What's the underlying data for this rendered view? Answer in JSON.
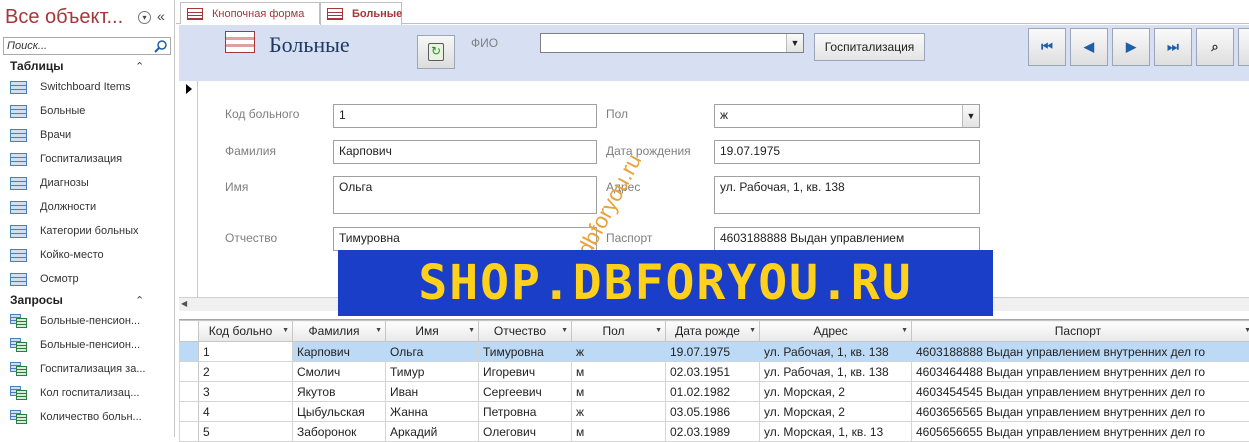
{
  "nav": {
    "title": "Все объект...",
    "search_placeholder": "Поиск...",
    "groups": [
      {
        "label": "Таблицы",
        "items": [
          "Switchboard Items",
          "Больные",
          "Врачи",
          "Госпитализация",
          "Диагнозы",
          "Должности",
          "Категории больных",
          "Койко-место",
          "Осмотр"
        ]
      },
      {
        "label": "Запросы",
        "items": [
          "Больные-пенсион...",
          "Больные-пенсион...",
          "Госпитализация за...",
          "Кол госпитализац...",
          "Количество больн..."
        ]
      }
    ]
  },
  "tabs": [
    {
      "label": "Кнопочная форма",
      "active": false
    },
    {
      "label": "Больные",
      "active": true
    }
  ],
  "header": {
    "title": "Больные",
    "fio_label": "ФИО",
    "fio_value": "",
    "hospitalize_button": "Госпитализация",
    "nav_buttons": [
      "first-record-icon",
      "prev-record-icon",
      "next-record-icon",
      "last-record-icon",
      "find-icon"
    ]
  },
  "form": {
    "labels": {
      "code": "Код больного",
      "surname": "Фамилия",
      "name": "Имя",
      "patronymic": "Отчество",
      "sex": "Пол",
      "birthdate": "Дата рождения",
      "address": "Адрес",
      "passport": "Паспорт"
    },
    "values": {
      "code": "1",
      "surname": "Карпович",
      "name": "Ольга",
      "patronymic": "Тимуровна",
      "sex": "ж",
      "birthdate": "19.07.1975",
      "address": "ул. Рабочая, 1, кв. 138",
      "passport": "4603188888 Выдан управлением"
    }
  },
  "watermarks": {
    "diagonal": "dbforyou.ru",
    "banner": "SHOP.DBFORYOU.RU"
  },
  "datasheet": {
    "columns": [
      "Код больно",
      "Фамилия",
      "Имя",
      "Отчество",
      "Пол",
      "Дата рожде",
      "Адрес",
      "Паспорт"
    ],
    "rows": [
      [
        "1",
        "Карпович",
        "Ольга",
        "Тимуровна",
        "ж",
        "19.07.1975",
        "ул. Рабочая, 1, кв. 138",
        "4603188888 Выдан управлением внутренних дел го"
      ],
      [
        "2",
        "Смолич",
        "Тимур",
        "Игоревич",
        "м",
        "02.03.1951",
        "ул. Рабочая, 1, кв. 138",
        "4603464488 Выдан управлением внутренних дел го"
      ],
      [
        "3",
        "Якутов",
        "Иван",
        "Сергеевич",
        "м",
        "01.02.1982",
        "ул. Морская,  2",
        "4603454545 Выдан управлением внутренних дел го"
      ],
      [
        "4",
        "Цыбульская",
        "Жанна",
        "Петровна",
        "ж",
        "03.05.1986",
        "ул. Морская,  2",
        "4603656565 Выдан управлением внутренних дел го"
      ],
      [
        "5",
        "Заборонок",
        "Аркадий",
        "Олегович",
        "м",
        "02.03.1989",
        "ул. Морская, 1, кв. 13",
        "4605656655 Выдан управлением внутренних дел го"
      ]
    ]
  },
  "colors": {
    "accent": "#a4373a",
    "header_bg": "#d6e0f2",
    "selection": "#bcd9f5",
    "banner_bg": "#1a3ec8",
    "banner_text": "#ffd11a",
    "watermark": "#e8a23a"
  }
}
